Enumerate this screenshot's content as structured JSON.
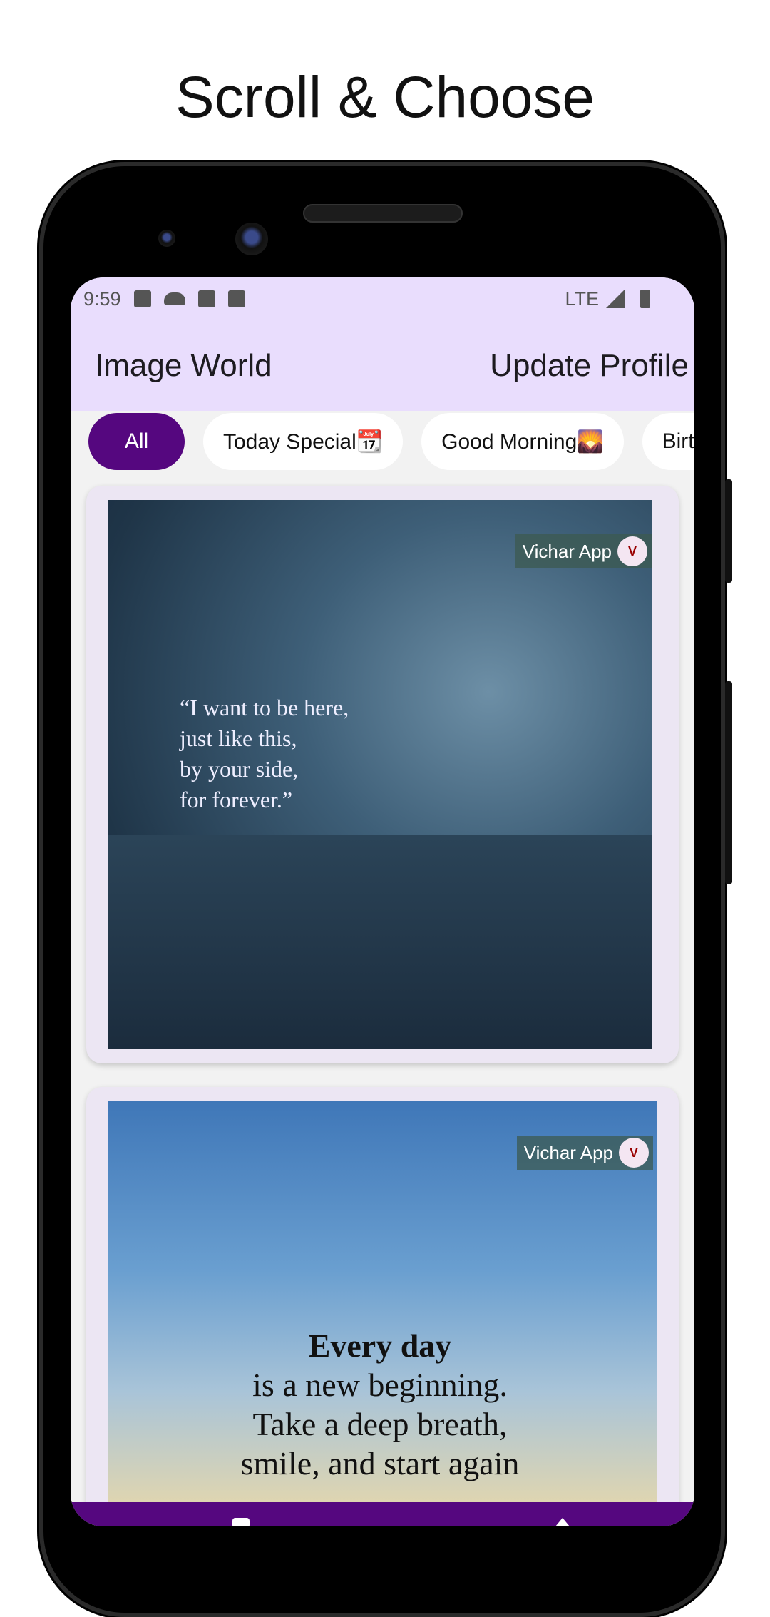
{
  "headline": "Scroll & Choose",
  "status_bar": {
    "time": "9:59",
    "network": "LTE",
    "icons": [
      "a-icon",
      "cloud-icon",
      "calendar-icon",
      "calendar-icon",
      "signal-icon",
      "battery-icon"
    ]
  },
  "app_bar": {
    "title": "Image World",
    "action": "Update Profile"
  },
  "chips": [
    {
      "label": "All",
      "active": true
    },
    {
      "label": "Today Special📆"
    },
    {
      "label": "Good Morning🌄"
    },
    {
      "label": "Birth"
    }
  ],
  "cards": [
    {
      "watermark": "Vichar App",
      "quote": [
        "“I want to be here,",
        "just like this,",
        "by your side,",
        "for forever.”"
      ]
    },
    {
      "watermark": "Vichar App",
      "quote": [
        "Every day",
        "is a new beginning.",
        "Take a deep breath,",
        "smile, and start again"
      ]
    }
  ],
  "colors": {
    "accent": "#55077f",
    "app_bar": "#e9ddfd",
    "card": "#ece6f3"
  }
}
